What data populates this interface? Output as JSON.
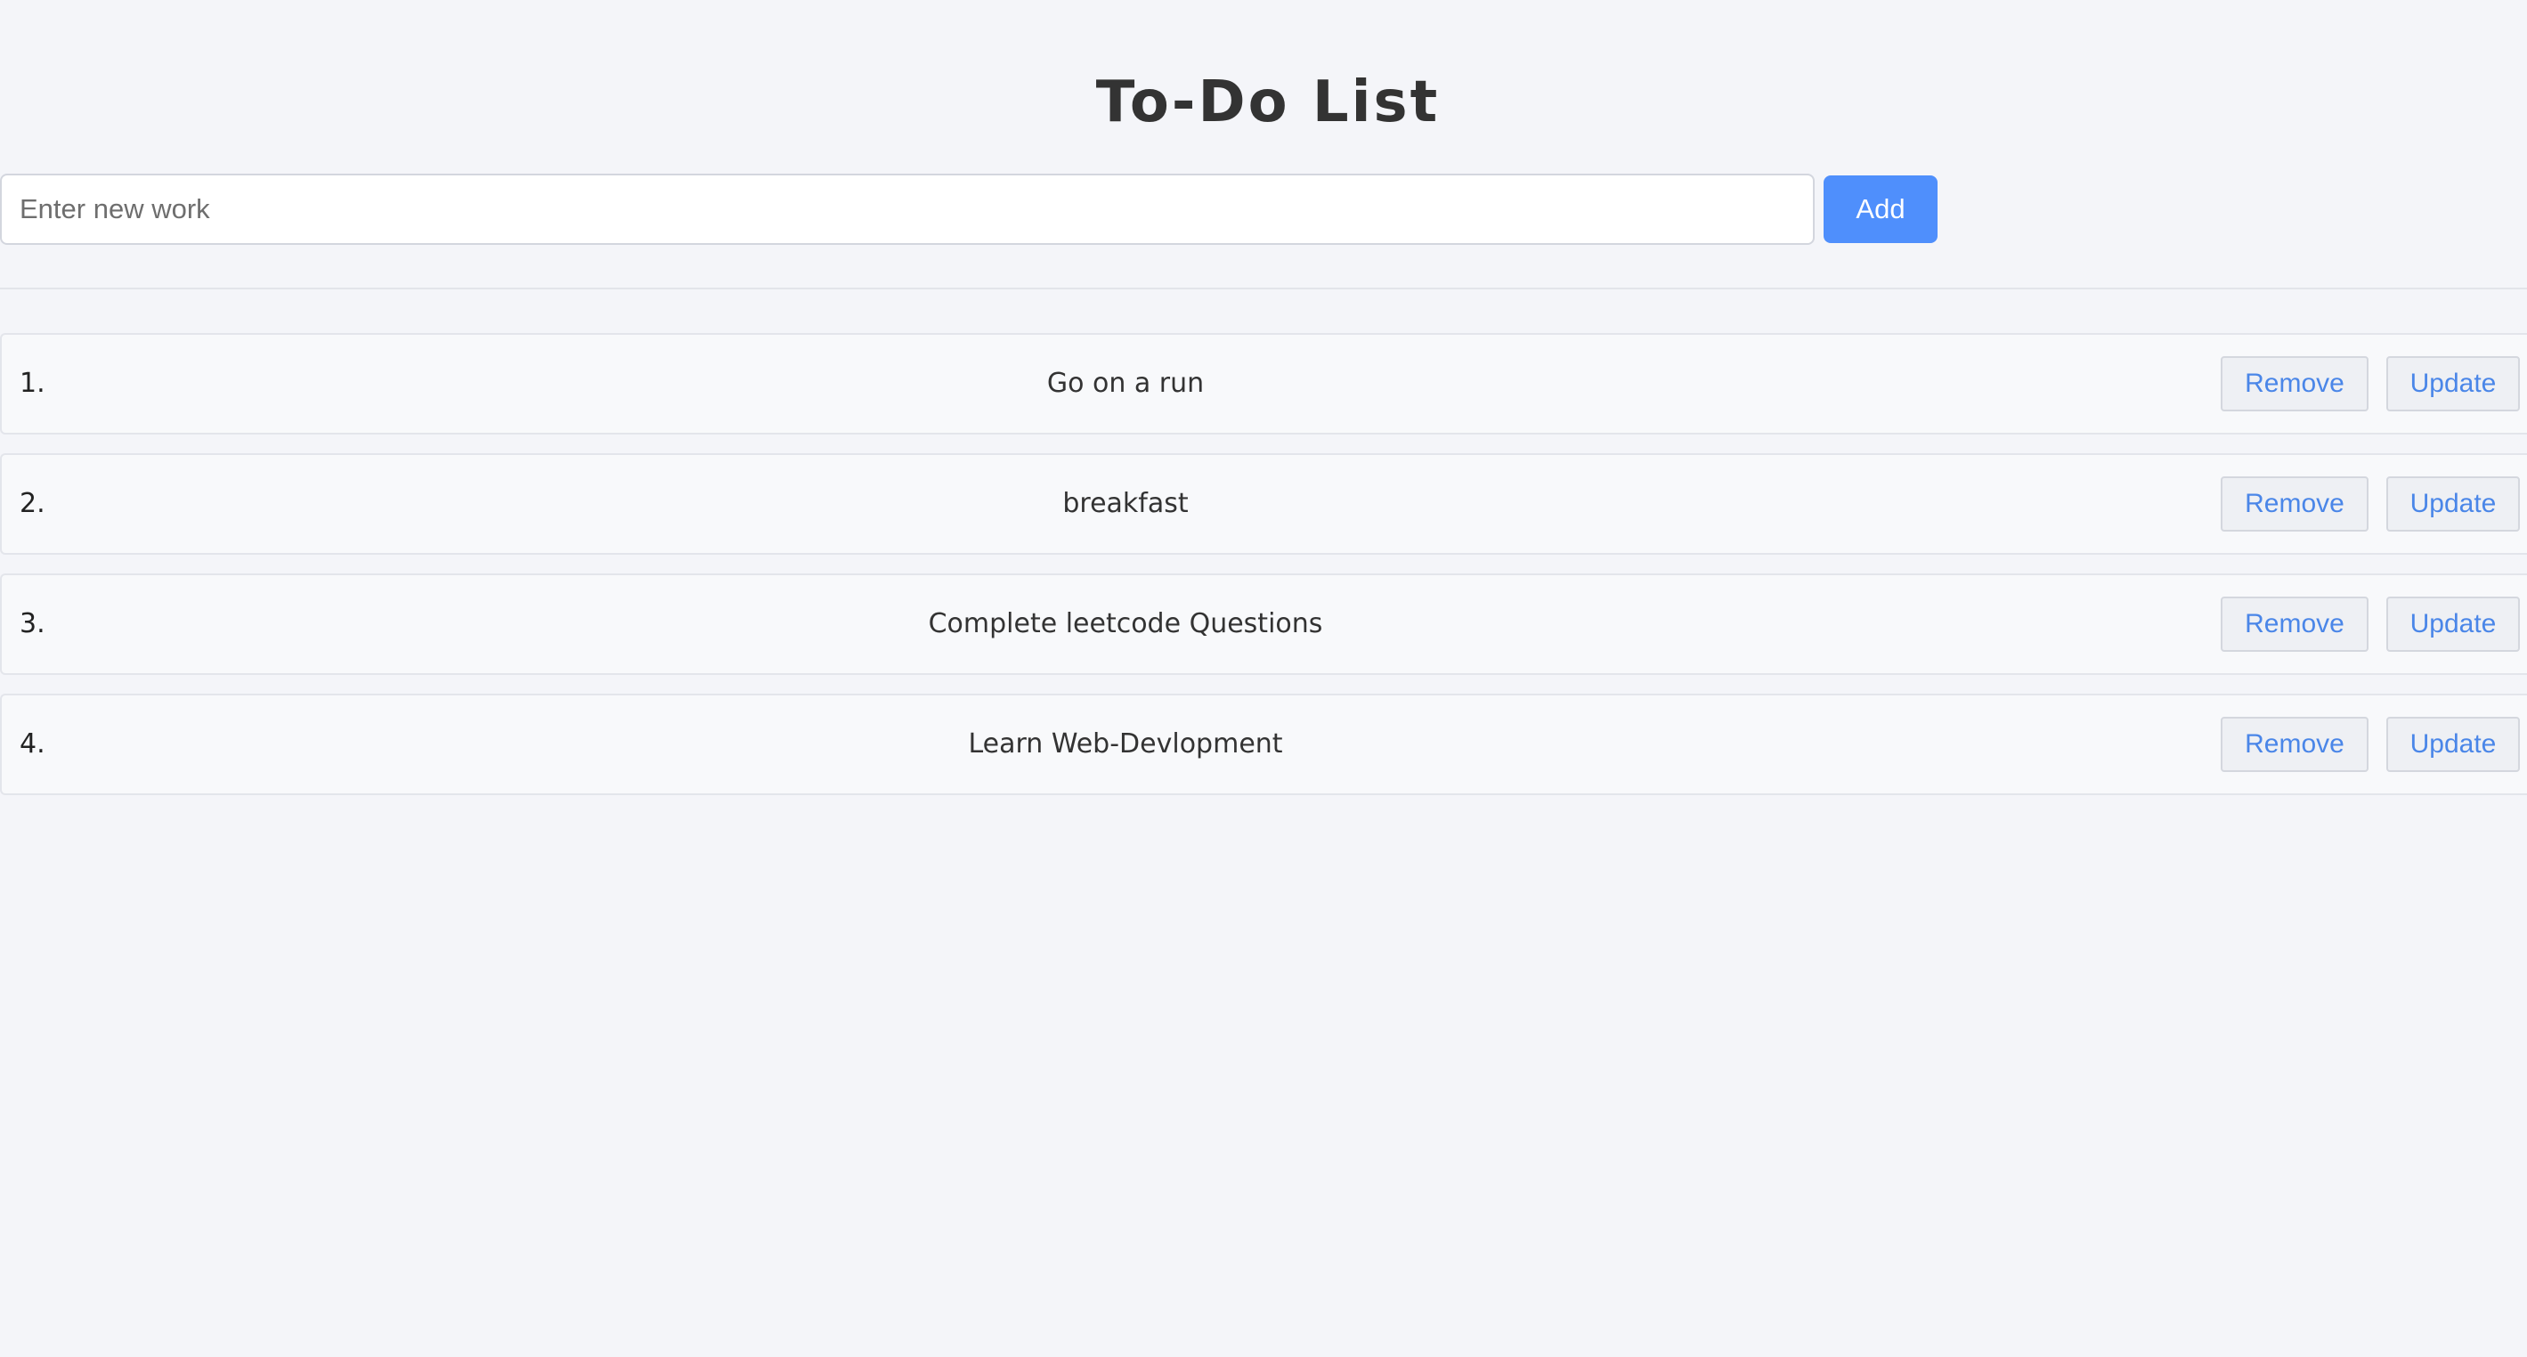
{
  "header": {
    "title": "To-Do List"
  },
  "add_bar": {
    "input_value": "",
    "input_placeholder": "Enter new work",
    "add_label": "Add"
  },
  "todos": [
    {
      "number": "1.",
      "text": "Go on a run",
      "remove_label": "Remove",
      "update_label": "Update"
    },
    {
      "number": "2.",
      "text": "breakfast",
      "remove_label": "Remove",
      "update_label": "Update"
    },
    {
      "number": "3.",
      "text": "Complete leetcode Questions",
      "remove_label": "Remove",
      "update_label": "Update"
    },
    {
      "number": "4.",
      "text": "Learn Web-Devlopment",
      "remove_label": "Remove",
      "update_label": "Update"
    }
  ],
  "colors": {
    "background": "#f4f5f9",
    "accent": "#4f8ffc",
    "item_button_text": "#4a86e8"
  }
}
